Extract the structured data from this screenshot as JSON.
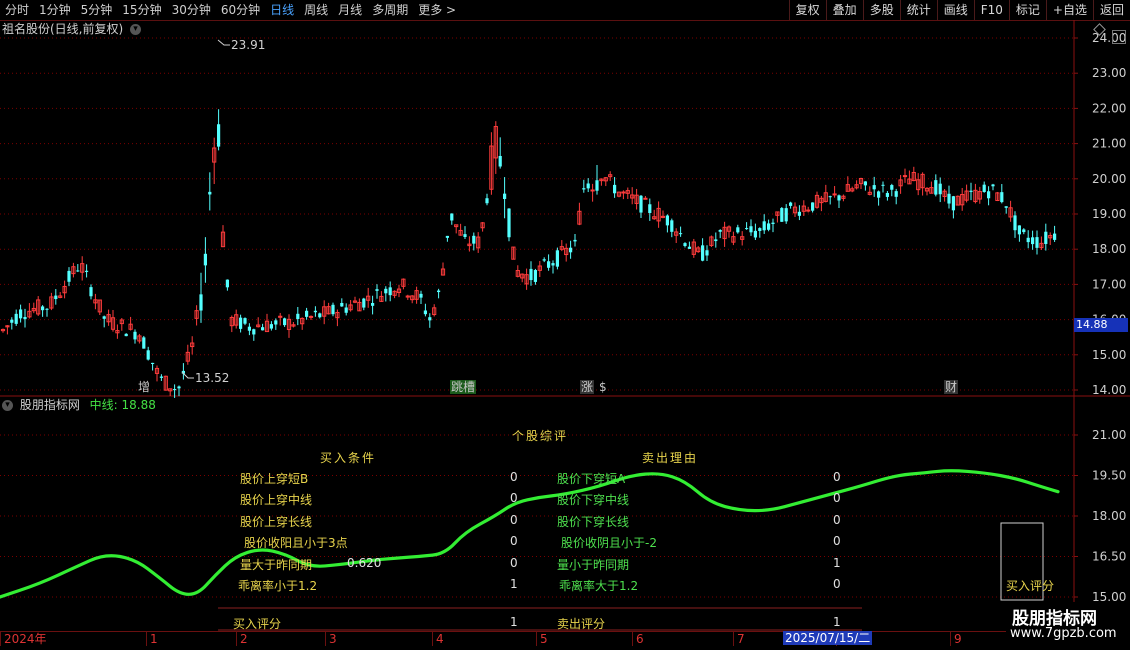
{
  "toolbar": {
    "periods": [
      "分时",
      "1分钟",
      "5分钟",
      "15分钟",
      "30分钟",
      "60分钟",
      "日线",
      "周线",
      "月线",
      "多周期",
      "更多 >"
    ],
    "active_period": "日线",
    "actions": [
      "复权",
      "叠加",
      "多股",
      "统计",
      "画线",
      "F10",
      "标记",
      "+自选",
      "返回"
    ]
  },
  "main_panel": {
    "title": "祖名股份(日线,前复权)",
    "y_ticks": [
      "24.00",
      "23.00",
      "22.00",
      "21.00",
      "20.00",
      "19.00",
      "18.00",
      "17.00",
      "16.00",
      "15.00",
      "14.00"
    ],
    "current_price": "14.88",
    "high_label": "23.91",
    "low_label": "13.52",
    "events": [
      {
        "text": "增",
        "color": "#ff5050"
      },
      {
        "text": "跳槽",
        "color": "#ffd040"
      },
      {
        "text": "涨",
        "color": "#ff5050"
      },
      {
        "text": "$",
        "color": "#ff5050"
      },
      {
        "text": "财",
        "color": "#50b0ff"
      }
    ]
  },
  "indicator_panel": {
    "title": "股朋指标网",
    "mid_label": "中线: 18.88",
    "y_ticks": [
      "21.00",
      "19.50",
      "18.00",
      "16.50",
      "15.00"
    ],
    "heading": "个股综评",
    "buy_header": "买入条件",
    "sell_header": "卖出理由",
    "buy_rows": [
      {
        "label": "股价上穿短B",
        "value": "0"
      },
      {
        "label": "股价上穿中线",
        "value": "0"
      },
      {
        "label": "股价上穿长线",
        "value": "0"
      },
      {
        "label": "股价收阳且小于3点",
        "value": "0"
      },
      {
        "label": "量大于昨同期",
        "value": "0"
      },
      {
        "label": "乖离率小于1.2",
        "value": "1"
      }
    ],
    "vol_ratio": "0.620",
    "sell_rows": [
      {
        "label": "股价下穿短A",
        "value": "0"
      },
      {
        "label": "股价下穿中线",
        "value": "0"
      },
      {
        "label": "股价下穿长线",
        "value": "0"
      },
      {
        "label": "股价收阴且小于-2",
        "value": "0"
      },
      {
        "label": "量小于昨同期",
        "value": "1"
      },
      {
        "label": "乖离率大于1.2",
        "value": "0"
      }
    ],
    "buy_score_label": "买入评分",
    "buy_score": "1",
    "sell_score_label": "卖出评分",
    "sell_score": "1",
    "score_box_label": "买入评分"
  },
  "x_axis": {
    "labels": [
      "2024年",
      "1",
      "2",
      "3",
      "4",
      "5",
      "6",
      "7",
      "8",
      "9"
    ],
    "cursor_date": "2025/07/15/二"
  },
  "watermark": {
    "name": "股朋指标网",
    "url": "www.7gpzb.com"
  },
  "colors": {
    "up": "#ff3c3c",
    "down": "#54ffff",
    "grid": "#7a0000",
    "curve": "#33ee33",
    "accent": "#1632b8"
  }
}
